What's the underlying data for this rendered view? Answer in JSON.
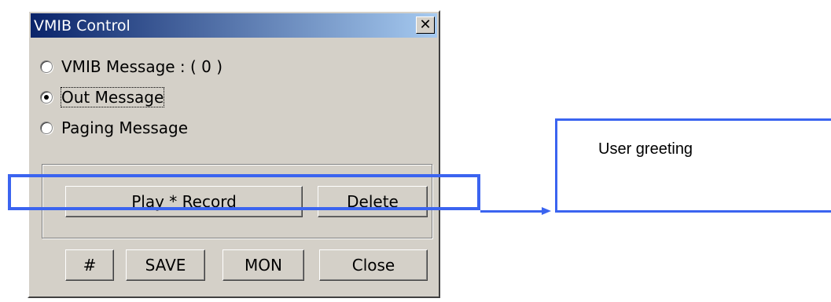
{
  "window": {
    "title": "VMIB Control",
    "close_glyph": "✕",
    "close_icon": "close-icon"
  },
  "options": [
    {
      "label": "VMIB Message : ( 0 )",
      "checked": false
    },
    {
      "label": "Out Message",
      "checked": true
    },
    {
      "label": "Paging Message",
      "checked": false
    }
  ],
  "group_buttons": {
    "play_record": "Play * Record",
    "delete": "Delete"
  },
  "bottom_buttons": {
    "hash": "#",
    "save": "SAVE",
    "mon": "MON",
    "close": "Close"
  },
  "annotation": {
    "callout_text": "User greeting",
    "color": "#3b64f0"
  },
  "colors": {
    "title_gradient_start": "#0a246a",
    "title_gradient_end": "#a6caf0",
    "face": "#d4d0c8"
  }
}
